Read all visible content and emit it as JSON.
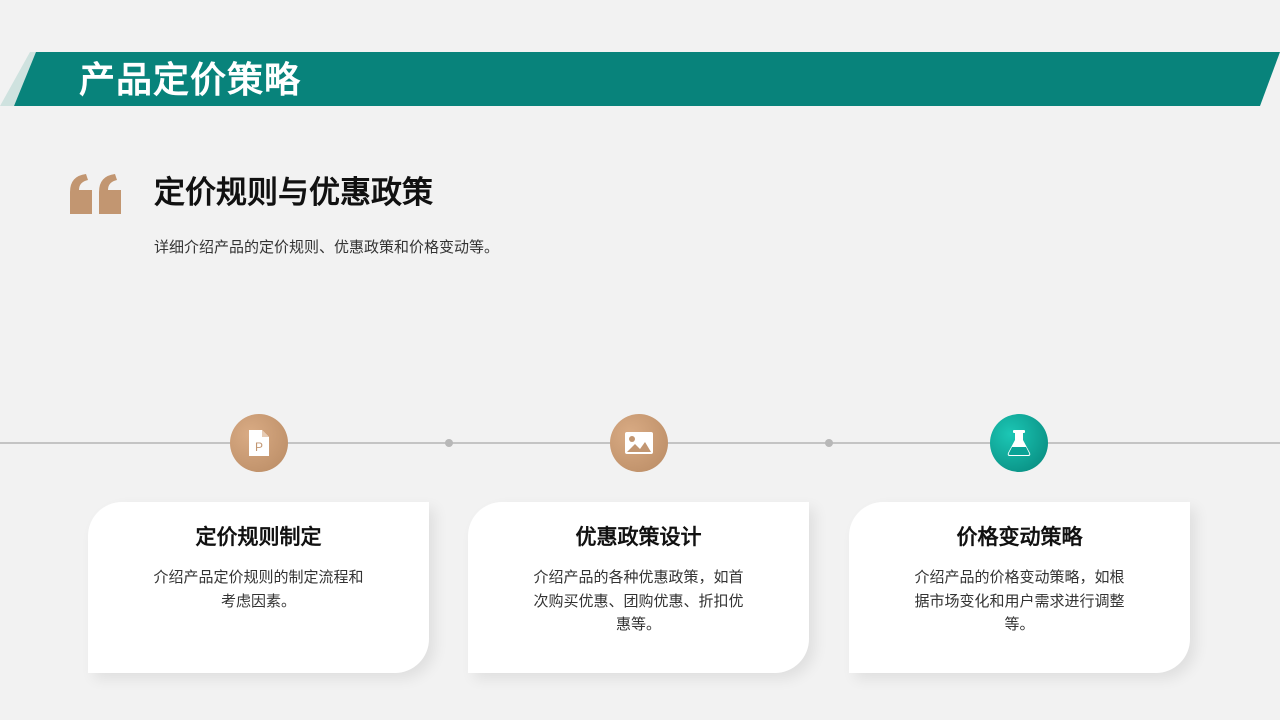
{
  "page": {
    "title": "产品定价策略",
    "accent_color": "#08837b",
    "brown_color": "#c29671"
  },
  "quote": {
    "icon": "quote-mark-icon",
    "title": "定价规则与优惠政策",
    "description": "详细介绍产品的定价规则、优惠政策和价格变动等。"
  },
  "timeline": {
    "items": [
      {
        "icon": "document-p-icon",
        "title": "定价规则制定",
        "description": "介绍产品定价规则的制定流程和考虑因素。"
      },
      {
        "icon": "image-icon",
        "title": "优惠政策设计",
        "description": "介绍产品的各种优惠政策，如首次购买优惠、团购优惠、折扣优惠等。"
      },
      {
        "icon": "flask-icon",
        "title": "价格变动策略",
        "description": "介绍产品的价格变动策略，如根据市场变化和用户需求进行调整等。"
      }
    ]
  }
}
